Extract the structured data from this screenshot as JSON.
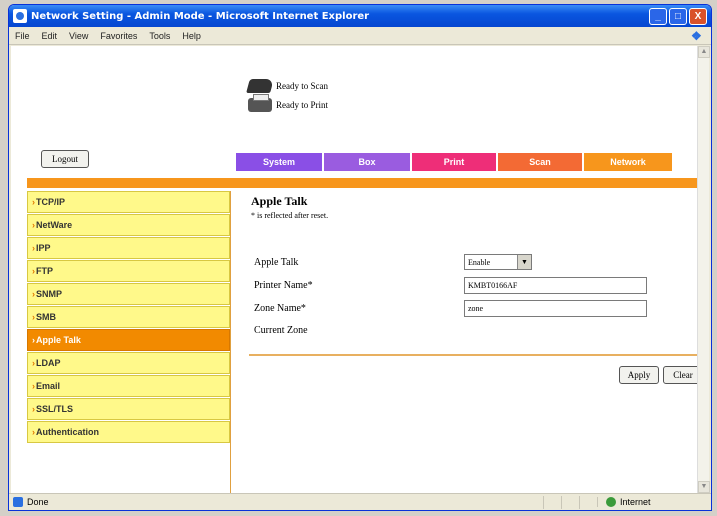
{
  "window": {
    "title": "Network Setting - Admin Mode - Microsoft Internet Explorer",
    "min_label": "_",
    "max_label": "□",
    "close_label": "X"
  },
  "menubar": {
    "items": [
      "File",
      "Edit",
      "View",
      "Favorites",
      "Tools",
      "Help"
    ]
  },
  "device_status": {
    "scan": "Ready to Scan",
    "print": "Ready to Print"
  },
  "logout_label": "Logout",
  "tabs": [
    "System",
    "Box",
    "Print",
    "Scan",
    "Network"
  ],
  "tab_colors": {
    "system": "#8a4fe6",
    "box": "#9a5ce0",
    "print": "#ee2e78",
    "scan": "#f36a34",
    "network": "#f7961c"
  },
  "sidebar": {
    "arrow": "›",
    "items": [
      "TCP/IP",
      "NetWare",
      "IPP",
      "FTP",
      "SNMP",
      "SMB",
      "Apple Talk",
      "LDAP",
      "Email",
      "SSL/TLS",
      "Authentication"
    ],
    "active_index": 6
  },
  "main": {
    "title": "Apple Talk",
    "note": "* is reflected after reset.",
    "fields": {
      "apple_talk_label": "Apple Talk",
      "apple_talk_value": "Enable",
      "printer_name_label": "Printer Name*",
      "printer_name_value": "KMBT0166AF",
      "zone_name_label": "Zone Name*",
      "zone_name_value": "zone",
      "current_zone_label": "Current Zone"
    },
    "apply_label": "Apply",
    "clear_label": "Clear"
  },
  "statusbar": {
    "text": "Done",
    "zone": "Internet"
  }
}
